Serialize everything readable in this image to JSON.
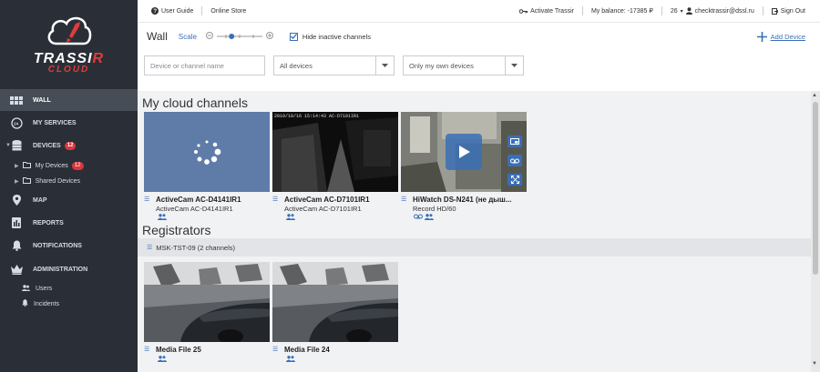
{
  "brand": {
    "name_main": "TRASSI",
    "name_r": "R",
    "name_sub": "CLOUD"
  },
  "sidebar": {
    "wall": "WALL",
    "services": "MY SERVICES",
    "devices": "DEVICES",
    "devices_count": "12",
    "my_devices": "My Devices",
    "my_devices_count": "12",
    "shared_devices": "Shared Devices",
    "map": "MAP",
    "reports": "REPORTS",
    "notifications": "NOTIFICATIONS",
    "administration": "ADMINISTRATION",
    "users": "Users",
    "incidents": "Incidents"
  },
  "topbar": {
    "user_guide": "User Guide",
    "online_store": "Online Store",
    "activate": "Activate Trassir",
    "balance": "My balance: -17385 ₽",
    "user_count": "26",
    "email": "checktrassir@dssl.ru",
    "sign_out": "Sign Out"
  },
  "toolbar": {
    "title": "Wall",
    "scale": "Scale",
    "hide_inactive": "Hide inactive channels",
    "add_device": "Add Device",
    "scale_level": 0.3
  },
  "filters": {
    "search_placeholder": "Device or channel name",
    "devices_select": "All devices",
    "owner_select": "Only my own devices"
  },
  "sections": {
    "cloud_title": "My cloud channels",
    "registrators_title": "Registrators",
    "registrator_name": "MSK-TST-09 (2 channels)"
  },
  "channels": [
    {
      "title": "ActiveCam AC-D4141IR1",
      "subtitle": "ActiveCam AC-D4141IR1"
    },
    {
      "title": "ActiveCam AC-D7101IR1",
      "subtitle": "ActiveCam AC-D7101IR1",
      "overlay": "2019/10/16 15:14:43 AC-D7101IR1"
    },
    {
      "title": "HiWatch DS-N241 (не дыш...",
      "subtitle": "Record HD/60"
    }
  ],
  "registrator_channels": [
    {
      "title": "Media File 25"
    },
    {
      "title": "Media File 24"
    }
  ],
  "colors": {
    "sidebar": "#2a2f37",
    "accent": "#3a6fb5",
    "badge": "#d9363e",
    "loading_tile": "#5f7ca8"
  }
}
